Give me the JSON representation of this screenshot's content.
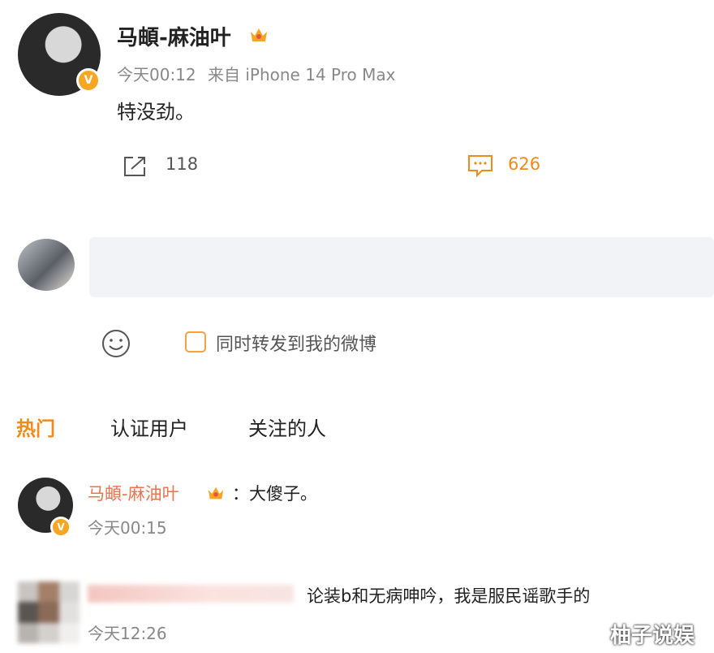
{
  "post": {
    "author": "马頔-麻油叶",
    "time": "今天00:12",
    "source": "来自 iPhone 14 Pro Max",
    "text": "特没劲。",
    "repost_count": "118",
    "comment_count": "626"
  },
  "composer": {
    "repost_checkbox_label": "同时转发到我的微博",
    "emoji_icon": "smile-icon"
  },
  "tabs": [
    {
      "label": "热门",
      "active": true
    },
    {
      "label": "认证用户",
      "active": false
    },
    {
      "label": "关注的人",
      "active": false
    }
  ],
  "comments": [
    {
      "author": "马頔-麻油叶",
      "separator": "：",
      "text": "大傻子。",
      "time": "今天00:15"
    },
    {
      "text": "论装b和无病呻吟，我是服民谣歌手的",
      "time": "今天12:26"
    }
  ],
  "watermark": "柚子说娱",
  "colors": {
    "accent": "#f08a1a",
    "badge": "#f6a623",
    "comment_name": "#eb7350"
  }
}
